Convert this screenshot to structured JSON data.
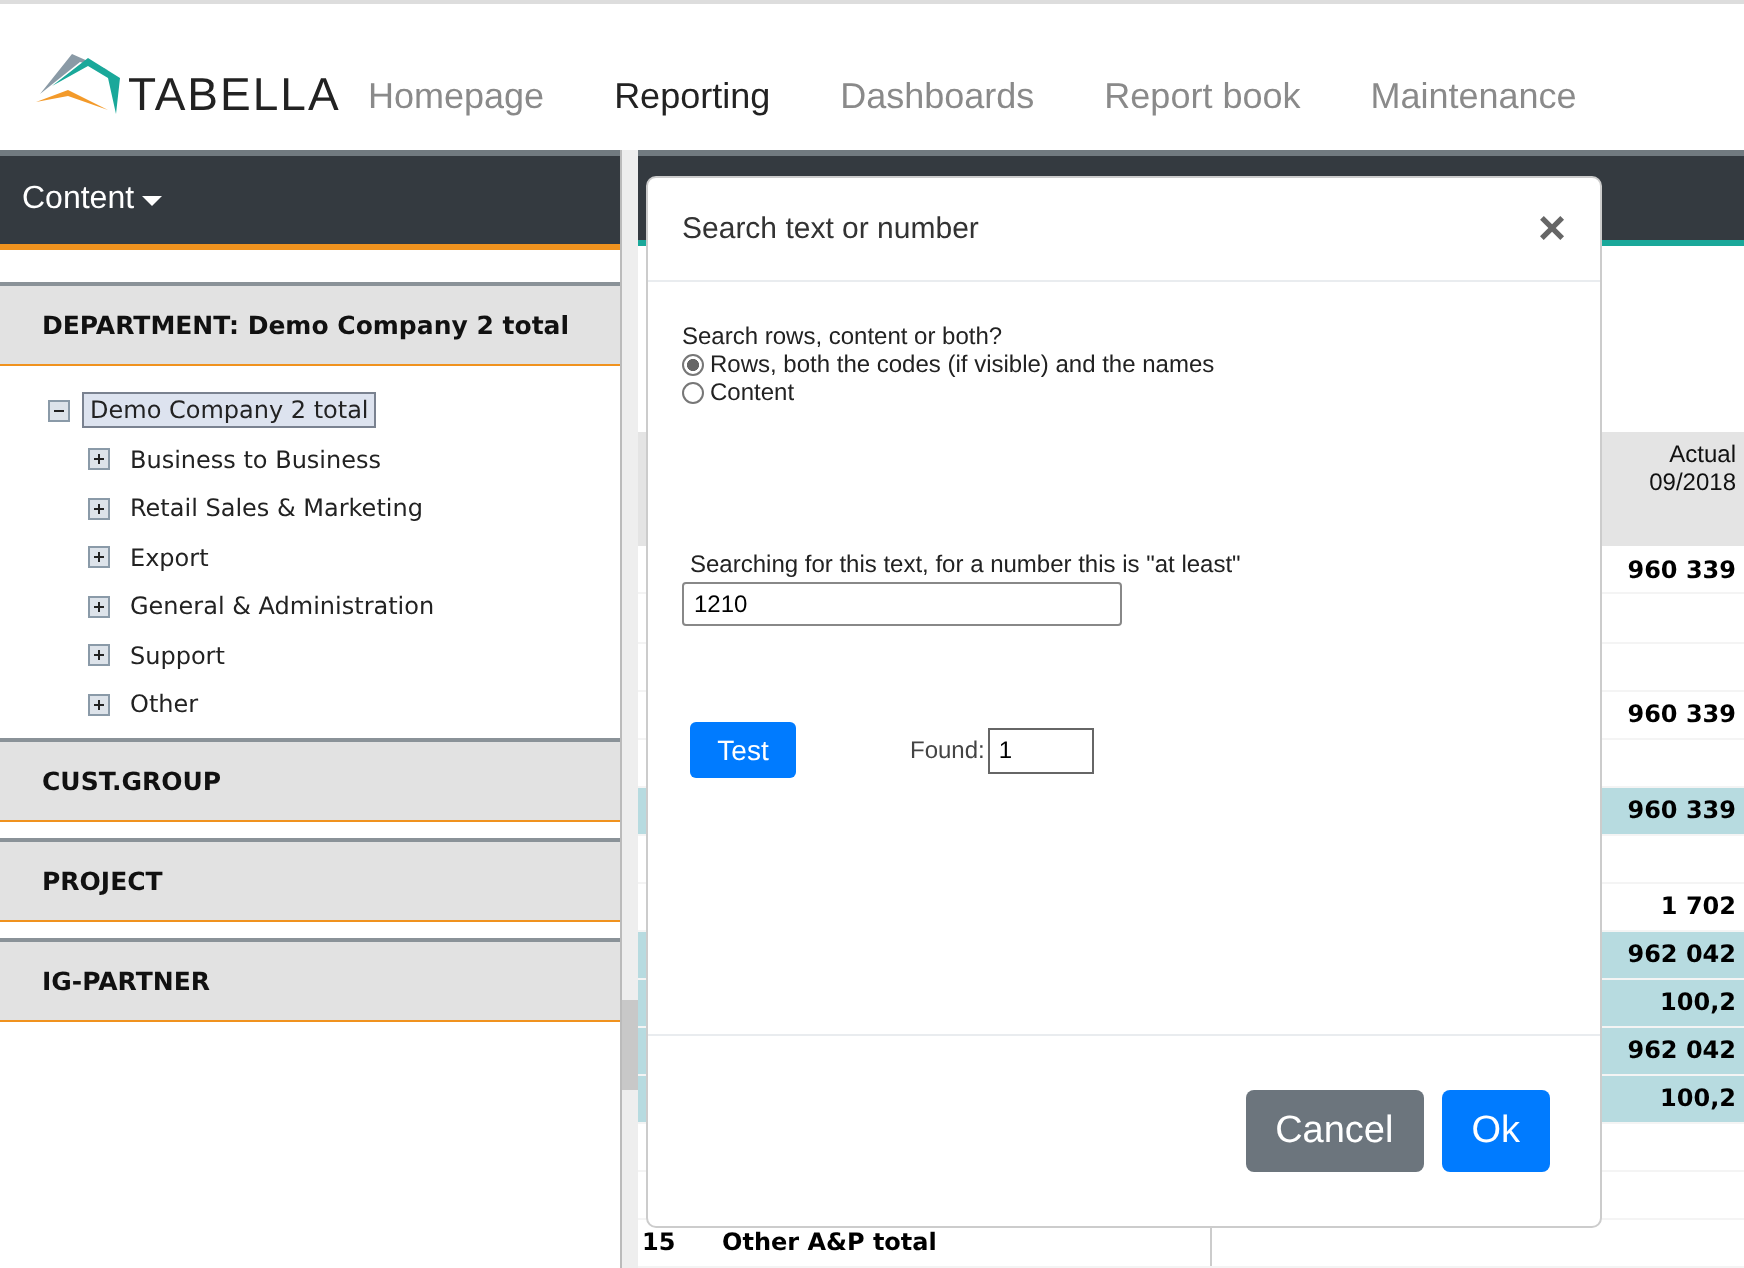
{
  "logo": {
    "text": "TABELLA"
  },
  "nav": [
    {
      "label": "Homepage",
      "selected": false
    },
    {
      "label": "Reporting",
      "selected": true
    },
    {
      "label": "Dashboards",
      "selected": false
    },
    {
      "label": "Report book",
      "selected": false
    },
    {
      "label": "Maintenance",
      "selected": false
    }
  ],
  "sidebar": {
    "menu": "Content",
    "sections": [
      {
        "title": "DEPARTMENT: Demo Company 2 total",
        "tree": [
          {
            "label": "Demo Company 2 total",
            "expanded": true,
            "selected": true,
            "children": [
              {
                "label": "Business to Business",
                "expanded": false,
                "selected": false
              },
              {
                "label": "Retail Sales & Marketing",
                "expanded": false,
                "selected": false
              },
              {
                "label": "Export",
                "expanded": false,
                "selected": false
              },
              {
                "label": "General & Administration",
                "expanded": false,
                "selected": false
              },
              {
                "label": "Support",
                "expanded": false,
                "selected": false
              },
              {
                "label": "Other",
                "expanded": false,
                "selected": false
              }
            ]
          }
        ]
      },
      {
        "title": "CUST.GROUP"
      },
      {
        "title": "PROJECT"
      },
      {
        "title": "IG-PARTNER"
      }
    ]
  },
  "table": {
    "value_header": [
      "Actual",
      "09/2018"
    ],
    "rows": [
      {
        "value": "960 339",
        "highlighted": false
      },
      {
        "highlighted": false
      },
      {
        "highlighted": false
      },
      {
        "value": "960 339",
        "highlighted": false
      },
      {
        "highlighted": false
      },
      {
        "value": "960 339",
        "highlighted": true
      },
      {
        "highlighted": false
      },
      {
        "value": "1 702",
        "highlighted": false
      },
      {
        "value": "962 042",
        "highlighted": true
      },
      {
        "value": "100,2",
        "highlighted": true
      },
      {
        "value": "962 042",
        "highlighted": true
      },
      {
        "value": "100,2",
        "highlighted": true
      },
      {
        "highlighted": false
      },
      {
        "highlighted": false
      },
      {
        "number": "15",
        "name": "Other A&P total",
        "highlighted": false
      }
    ]
  },
  "dialog": {
    "title": "Search text or number",
    "close": "×",
    "scope_label": "Search rows, content or both?",
    "options": [
      {
        "label": "Rows, both the codes (if visible) and the names",
        "selected": true
      },
      {
        "label": "Content",
        "selected": false
      }
    ],
    "search_label": "Searching for this text, for a number this is \"at least\"",
    "search_value": "1210",
    "test_button": "Test",
    "found_label": "Found:",
    "found_value": "1",
    "buttons": [
      {
        "label": "Cancel",
        "kind": "secondary"
      },
      {
        "label": "Ok",
        "kind": "primary"
      }
    ]
  }
}
